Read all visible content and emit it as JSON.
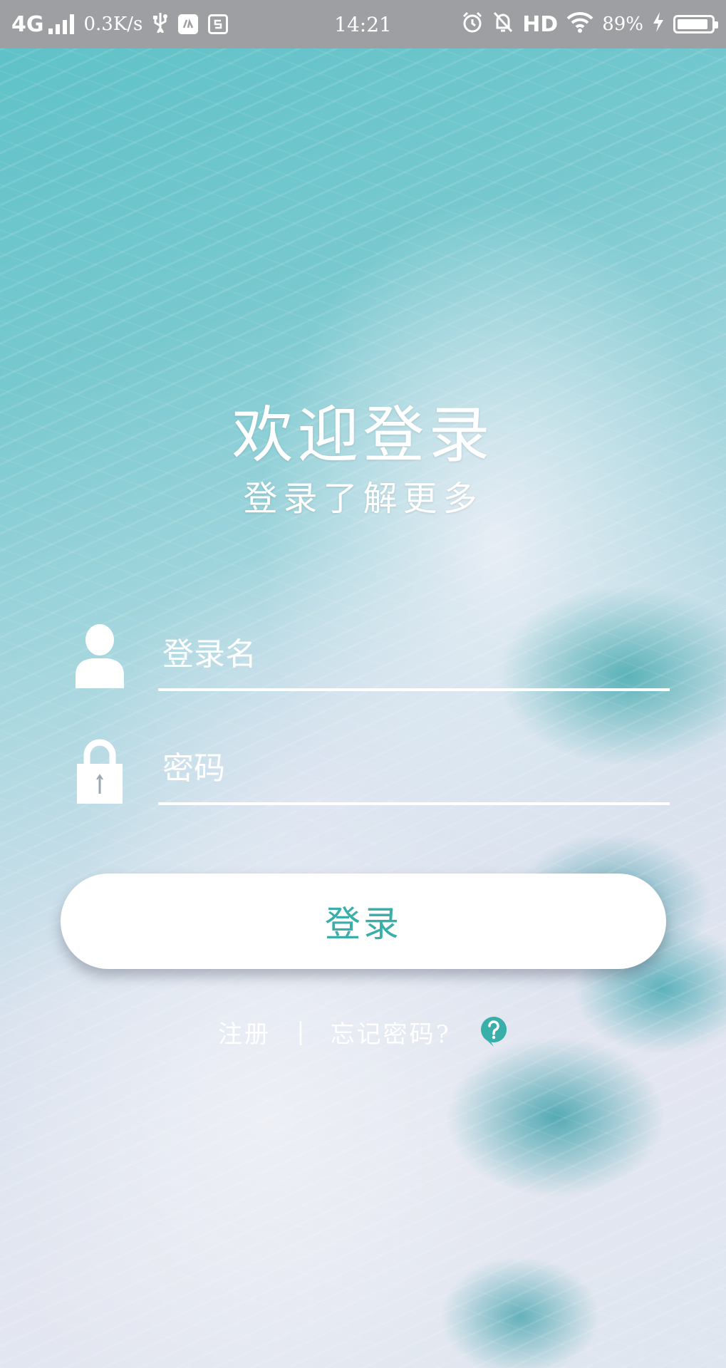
{
  "status_bar": {
    "network": "4G",
    "speed": "0.3K/s",
    "time": "14:21",
    "hd": "HD",
    "battery_percent": "89%",
    "icons": [
      "signal-icon",
      "usb-icon",
      "app-notification-icon",
      "screenshot-icon",
      "alarm-icon",
      "mute-icon",
      "wifi-icon",
      "charging-icon",
      "battery-icon"
    ]
  },
  "header": {
    "title": "欢迎登录",
    "subtitle": "登录了解更多"
  },
  "form": {
    "username_placeholder": "登录名",
    "password_placeholder": "密码",
    "login_label": "登录"
  },
  "links": {
    "register": "注册",
    "separator": "|",
    "forgot": "忘记密码?"
  },
  "colors": {
    "accent": "#3aaea8",
    "status_bar": "#9e9fa2",
    "text_on_bg": "#ffffff"
  }
}
